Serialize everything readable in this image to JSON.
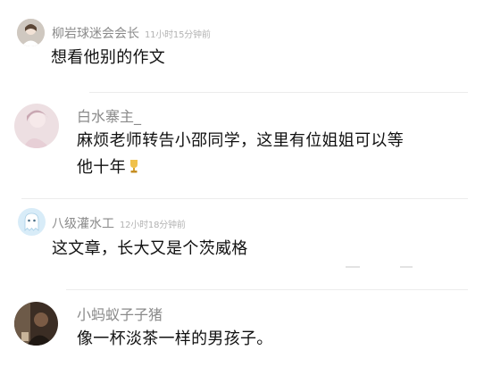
{
  "comments": [
    {
      "username": "柳岩球迷会会长",
      "time": "11小时15分钟前",
      "text": "想看他别的作文",
      "avatar": "person-avatar"
    },
    {
      "username": "白水寨主_",
      "time": "",
      "text_line1": "麻烦老师转告小邵同学，这里有位姐姐可以等",
      "text_line2": "他十年",
      "emoji": "trophy-emoji",
      "avatar": "portrait-avatar"
    },
    {
      "username": "八级灌水工",
      "time": "12小时18分钟前",
      "text": "这文章，长大又是个茨威格",
      "avatar": "ghost-avatar"
    },
    {
      "username": "小蚂蚁子子猪",
      "time": "",
      "text": "像一杯淡茶一样的男孩子。",
      "avatar": "dark-photo-avatar"
    }
  ],
  "colors": {
    "username": "#8a8a8a",
    "time": "#b3b3b3",
    "text": "#111111",
    "divider": "#ececec"
  }
}
